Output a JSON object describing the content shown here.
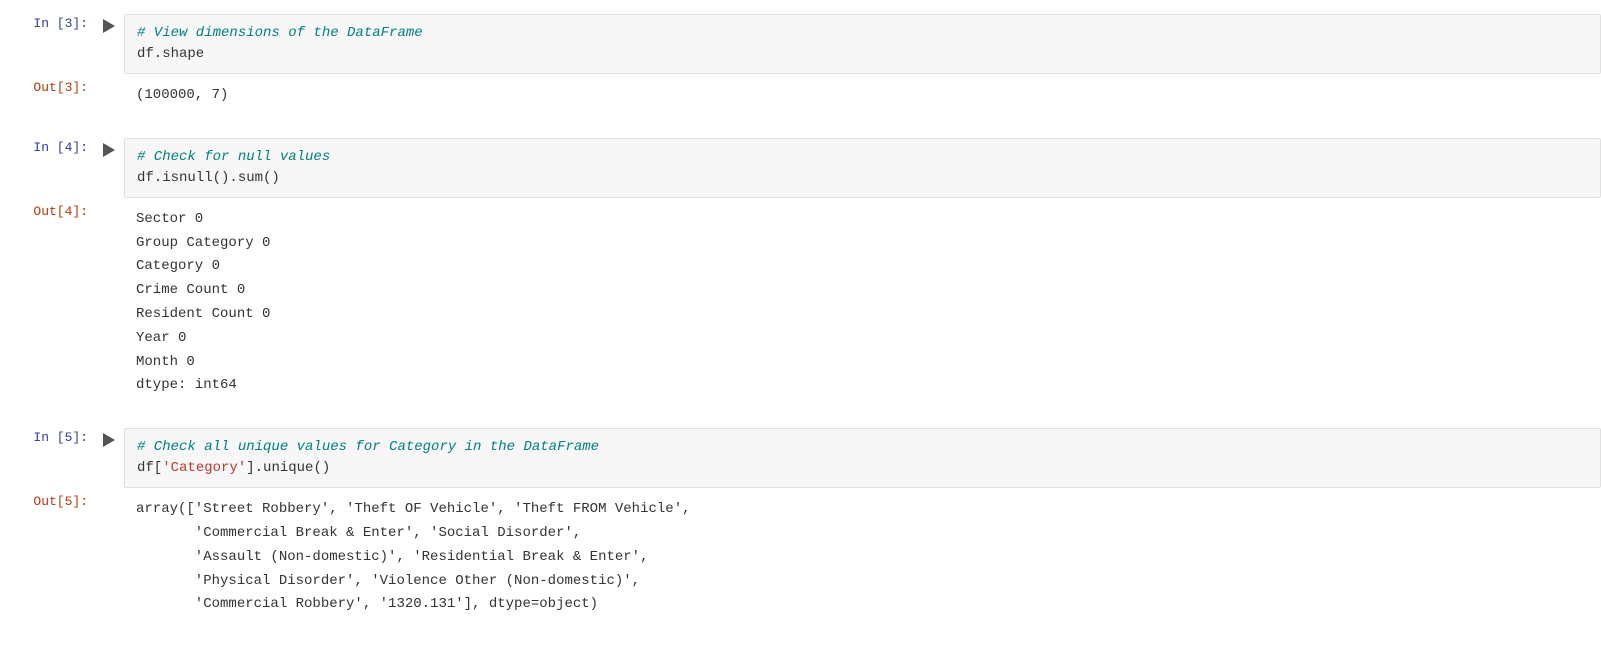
{
  "cells": [
    {
      "in_label": "In [3]:",
      "out_label": "Out[3]:",
      "code_lines": [
        {
          "type": "comment",
          "text": "# View dimensions of the DataFrame"
        },
        {
          "type": "normal",
          "text": "df.shape"
        }
      ],
      "output_lines": [
        {
          "type": "normal",
          "text": "(100000, 7)"
        }
      ]
    },
    {
      "in_label": "In [4]:",
      "out_label": "Out[4]:",
      "code_lines": [
        {
          "type": "comment",
          "text": "# Check for null values"
        },
        {
          "type": "normal",
          "text": "df.isnull().sum()"
        }
      ],
      "output_lines": [
        {
          "type": "normal",
          "text": "Sector             0"
        },
        {
          "type": "normal",
          "text": "Group Category     0"
        },
        {
          "type": "normal",
          "text": "Category           0"
        },
        {
          "type": "normal",
          "text": "Crime Count        0"
        },
        {
          "type": "normal",
          "text": "Resident Count     0"
        },
        {
          "type": "normal",
          "text": "Year               0"
        },
        {
          "type": "normal",
          "text": "Month              0"
        },
        {
          "type": "normal",
          "text": "dtype: int64"
        }
      ]
    },
    {
      "in_label": "In [5]:",
      "out_label": "Out[5]:",
      "code_lines": [
        {
          "type": "comment",
          "text": "# Check all unique values for Category in the DataFrame"
        },
        {
          "type": "mixed",
          "parts": [
            {
              "type": "normal",
              "text": "df["
            },
            {
              "type": "string",
              "text": "'Category'"
            },
            {
              "type": "normal",
              "text": "].unique()"
            }
          ]
        }
      ],
      "output_lines": [
        {
          "type": "normal",
          "text": "array(['Street Robbery', 'Theft OF Vehicle', 'Theft FROM Vehicle',"
        },
        {
          "type": "normal",
          "text": "       'Commercial Break & Enter', 'Social Disorder',"
        },
        {
          "type": "normal",
          "text": "       'Assault (Non-domestic)', 'Residential Break & Enter',"
        },
        {
          "type": "normal",
          "text": "       'Physical Disorder', 'Violence Other (Non-domestic)',"
        },
        {
          "type": "normal",
          "text": "       'Commercial Robbery', '1320.131'], dtype=object)"
        }
      ]
    }
  ],
  "labels": {
    "in3": "In [3]:",
    "out3": "Out[3]:",
    "in4": "In [4]:",
    "out4": "Out[4]:",
    "in5": "In [5]:",
    "out5": "Out[5]:"
  }
}
